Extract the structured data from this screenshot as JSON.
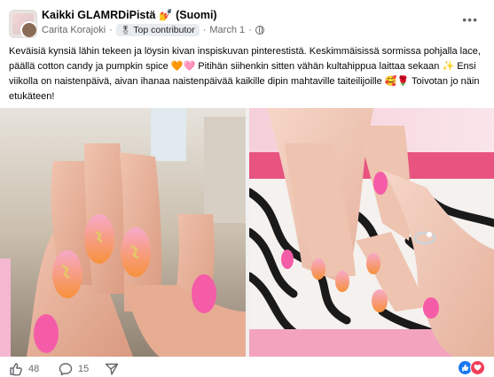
{
  "post": {
    "group_name": "Kaikki GLAMRDiPistä",
    "group_emoji": "💅",
    "group_suffix": "(Suomi)",
    "author": "Carita Korajoki",
    "separator": "·",
    "badge": "Top contributor",
    "date": "March 1",
    "caption": "Keväisiä kynsiä lähin tekeen ja löysin kivan inspiskuvan pinterestistä. Keskimmäisissä sormissa pohjalla lace, päällä cotton candy ja pumpkin spice 🧡🩷 Pitihän siihenkin sitten vähän kultahippua laittaa sekaan ✨ Ensi viikolla on naistenpäivä, aivan ihanaa naistenpäivää kaikille dipin mahtaville taiteilijoille 🥰🌹 Toivotan jo näin etukäteen!"
  },
  "footer": {
    "likes": "48",
    "comments": "15"
  },
  "icons": {
    "more": "more-icon",
    "like": "thumbs-up-icon",
    "comment": "comment-icon",
    "share": "share-icon",
    "globe": "globe-icon"
  },
  "colors": {
    "accent": "#1877f2",
    "love": "#f33e58",
    "secondary_text": "#65676b",
    "nail_pink": "#f55ca8",
    "nail_orange": "#f7913b"
  }
}
